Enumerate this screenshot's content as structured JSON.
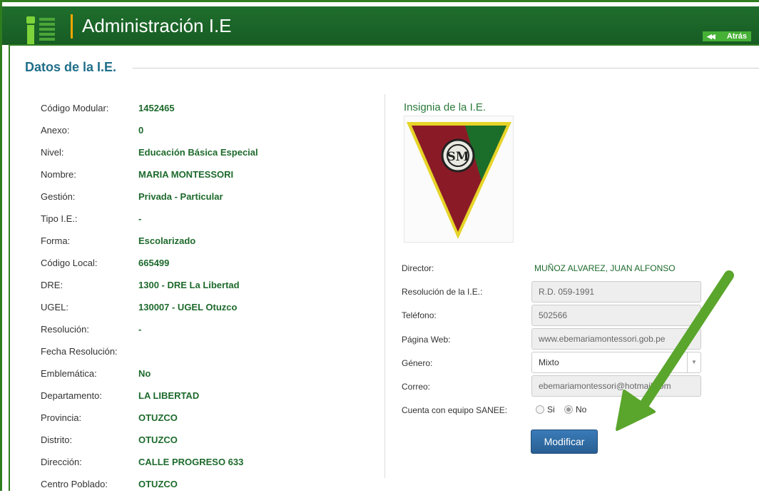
{
  "header": {
    "title": "Administración I.E",
    "back_label": "Atrás",
    "back_arrow": "◀◀"
  },
  "section": {
    "title": "Datos de la I.E."
  },
  "info_rows": [
    {
      "label": "Código Modular:",
      "value": "1452465"
    },
    {
      "label": "Anexo:",
      "value": "0"
    },
    {
      "label": "Nivel:",
      "value": "Educación Básica Especial"
    },
    {
      "label": "Nombre:",
      "value": "MARIA MONTESSORI"
    },
    {
      "label": "Gestión:",
      "value": "Privada - Particular"
    },
    {
      "label": "Tipo I.E.:",
      "value": "-"
    },
    {
      "label": "Forma:",
      "value": "Escolarizado"
    },
    {
      "label": "Código Local:",
      "value": "665499"
    },
    {
      "label": "DRE:",
      "value": "1300 - DRE La Libertad"
    },
    {
      "label": "UGEL:",
      "value": "130007 - UGEL Otuzco"
    },
    {
      "label": "Resolución:",
      "value": "-"
    },
    {
      "label": "Fecha Resolución:",
      "value": ""
    },
    {
      "label": "Emblemática:",
      "value": "No"
    },
    {
      "label": "Departamento:",
      "value": "LA LIBERTAD"
    },
    {
      "label": "Provincia:",
      "value": "OTUZCO"
    },
    {
      "label": "Distrito:",
      "value": "OTUZCO"
    },
    {
      "label": "Dirección:",
      "value": "CALLE PROGRESO 633"
    },
    {
      "label": "Centro Poblado:",
      "value": "OTUZCO"
    }
  ],
  "insignia": {
    "title": "Insignia de la I.E.",
    "emblem_text": "SM"
  },
  "form": {
    "director_label": "Director:",
    "director_value": "MUÑOZ ALVAREZ, JUAN ALFONSO",
    "resolucion_label": "Resolución de la I.E.:",
    "resolucion_value": "R.D. 059-1991",
    "telefono_label": "Teléfono:",
    "telefono_value": "502566",
    "web_label": "Página Web:",
    "web_value": "www.ebemariamontessori.gob.pe",
    "genero_label": "Género:",
    "genero_value": "Mixto",
    "correo_label": "Correo:",
    "correo_value": "ebemariamontessori@hotmail.com",
    "sanee_label": "Cuenta con equipo SANEE:",
    "sanee_options": [
      "Si",
      "No"
    ],
    "sanee_selected": "No",
    "submit_label": "Modificar"
  },
  "colors": {
    "header_green": "#1f6e2d",
    "value_green": "#1d6a2c",
    "title_teal": "#1f6e8a",
    "button_blue": "#2f6da6",
    "annotation_arrow": "#5aa52c"
  },
  "icons": {
    "back": "double-left-arrow-icon",
    "select_arrow": "chevron-down-icon"
  }
}
